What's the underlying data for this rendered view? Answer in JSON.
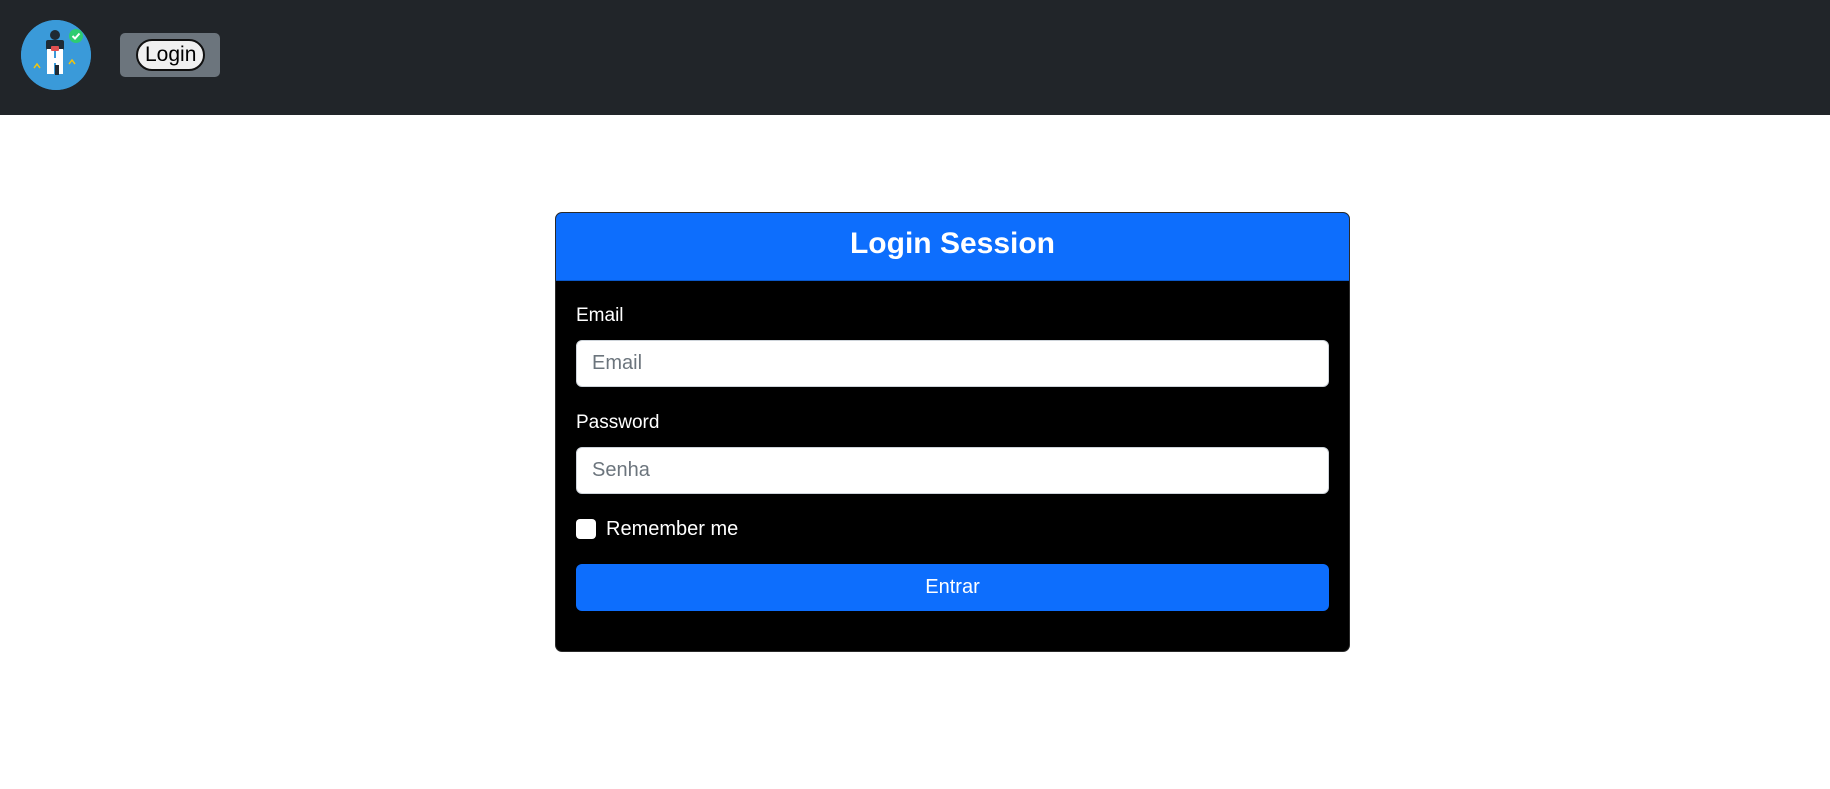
{
  "navbar": {
    "logo_icon": "security-guard-logo-icon",
    "login_button_label": "Login"
  },
  "card": {
    "title": "Login Session",
    "email": {
      "label": "Email",
      "placeholder": "Email",
      "value": ""
    },
    "password": {
      "label": "Password",
      "placeholder": "Senha",
      "value": ""
    },
    "remember_me": {
      "label": "Remember me",
      "checked": false
    },
    "submit_label": "Entrar"
  },
  "colors": {
    "navbar_bg": "#212529",
    "primary": "#0d6efd",
    "card_bg": "#000000",
    "nav_button_group": "#6c757d",
    "logo_bg": "#3a9ad9"
  }
}
